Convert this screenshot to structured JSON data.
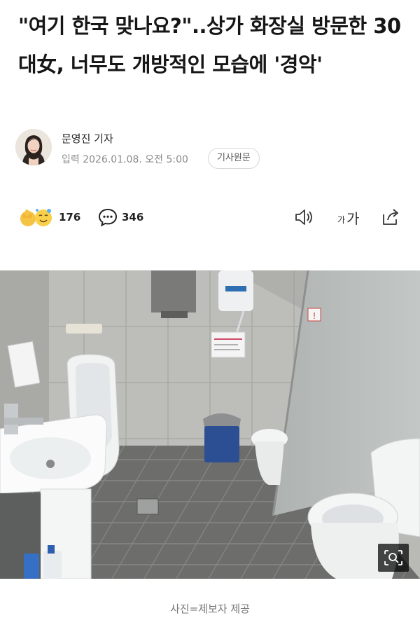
{
  "article": {
    "headline": "\"여기 한국 맞나요?\"..상가 화장실 방문한 30대女, 너무도 개방적인 모습에 '경악'"
  },
  "author": {
    "name": "문영진 기자",
    "published": "입력 2026.01.08. 오전 5:00",
    "source_button": "기사원문"
  },
  "actions": {
    "reaction_count": "176",
    "comment_count": "346",
    "icons": [
      "clap-emoji-icon",
      "comment-bubble-icon",
      "speaker-icon",
      "font-size-icon",
      "share-icon"
    ]
  },
  "photo": {
    "caption": "사진=제보자 제공",
    "sign_text": "!"
  }
}
